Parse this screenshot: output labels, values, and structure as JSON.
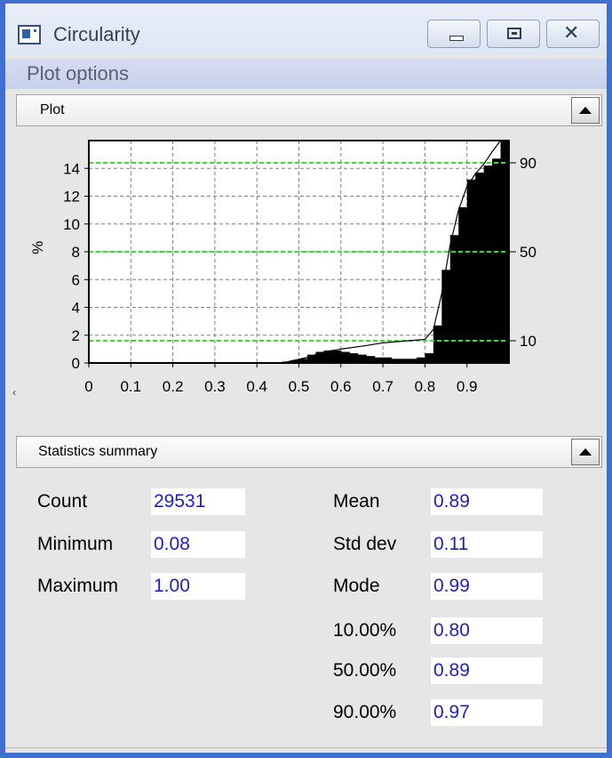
{
  "window": {
    "title": "Circularity",
    "accent": "#3f6fcf"
  },
  "titlebar_buttons": {
    "minimize_icon": "minimize-icon",
    "maximize_icon": "restore-icon",
    "close_icon": "close-icon",
    "close_glyph": "✕"
  },
  "menu": {
    "plot_options": "Plot options"
  },
  "plot_section": {
    "label": "Plot",
    "toggle_icon": "collapse-up-arrow-icon"
  },
  "stats_section": {
    "label": "Statistics summary",
    "toggle_icon": "collapse-up-arrow-icon"
  },
  "chart_data": {
    "type": "bar",
    "ylabel": "%",
    "xlim": [
      0,
      1.0
    ],
    "ylim": [
      0,
      16
    ],
    "x_ticks": [
      "0",
      "0.1",
      "0.2",
      "0.3",
      "0.4",
      "0.5",
      "0.6",
      "0.7",
      "0.8",
      "0.9"
    ],
    "y_ticks": [
      "0",
      "2",
      "4",
      "6",
      "8",
      "10",
      "12",
      "14"
    ],
    "right_ticks": [
      "10",
      "50",
      "90"
    ],
    "grid": true,
    "grid_color": "#808080",
    "bar_color": "#000000",
    "bin_width": 0.02,
    "bin_starts": [
      0.46,
      0.48,
      0.5,
      0.52,
      0.54,
      0.56,
      0.58,
      0.6,
      0.62,
      0.64,
      0.66,
      0.68,
      0.7,
      0.72,
      0.74,
      0.76,
      0.78,
      0.8,
      0.82,
      0.84,
      0.86,
      0.88,
      0.9,
      0.92,
      0.94,
      0.96,
      0.98
    ],
    "values": [
      0.1,
      0.2,
      0.3,
      0.6,
      0.8,
      0.9,
      0.9,
      0.8,
      0.7,
      0.6,
      0.5,
      0.4,
      0.4,
      0.3,
      0.3,
      0.3,
      0.4,
      0.7,
      2.7,
      6.7,
      9.2,
      11.2,
      13.2,
      13.7,
      14.2,
      14.7,
      16.0
    ],
    "cumulative": {
      "x": [
        0.46,
        0.52,
        0.56,
        0.6,
        0.66,
        0.7,
        0.76,
        0.8,
        0.82,
        0.84,
        0.86,
        0.88,
        0.9,
        0.92,
        0.94,
        0.96,
        0.98
      ],
      "y": [
        0.0,
        0.4,
        0.8,
        1.0,
        1.25,
        1.45,
        1.6,
        1.7,
        2.4,
        5.0,
        8.5,
        11.0,
        12.7,
        13.6,
        14.3,
        15.2,
        16.0
      ]
    },
    "reference_lines": {
      "y": [
        1.6,
        8.0,
        14.4
      ],
      "labels": [
        "10",
        "50",
        "90"
      ],
      "color": "#33dd33"
    }
  },
  "stats": {
    "count_label": "Count",
    "count_value": "29531",
    "minimum_label": "Minimum",
    "minimum_value": "0.08",
    "maximum_label": "Maximum",
    "maximum_value": "1.00",
    "mean_label": "Mean",
    "mean_value": "0.89",
    "stddev_label": "Std dev",
    "stddev_value": "0.11",
    "mode_label": "Mode",
    "mode_value": "0.99",
    "p10_label": "10.00%",
    "p10_value": "0.80",
    "p50_label": "50.00%",
    "p50_value": "0.89",
    "p90_label": "90.00%",
    "p90_value": "0.97",
    "value_color": "#1e1ec8"
  }
}
